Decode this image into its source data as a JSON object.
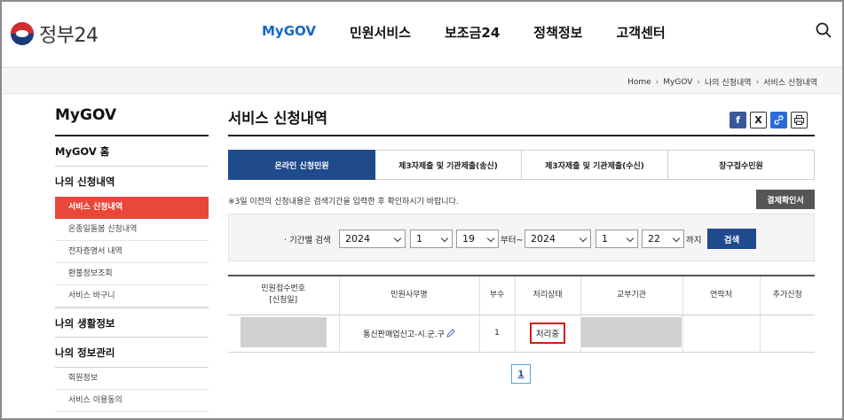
{
  "header": {
    "logo_text": "정부24",
    "nav": [
      "MyGOV",
      "민원서비스",
      "보조금24",
      "정책정보",
      "고객센터"
    ],
    "active_nav": "MyGOV"
  },
  "breadcrumb": [
    "Home",
    "MyGOV",
    "나의 신청내역",
    "서비스 신청내역"
  ],
  "sidebar": {
    "title": "MyGOV",
    "home": "MyGOV 홈",
    "section1": "나의 신청내역",
    "section1_items": [
      "서비스 신청내역",
      "온종일돌봄 신청내역",
      "전자증명서 내역",
      "환불정보조회",
      "서비스 바구니"
    ],
    "section2": "나의 생활정보",
    "section3": "나의 정보관리",
    "section3_items": [
      "회원정보",
      "서비스 이용동의"
    ]
  },
  "main": {
    "title": "서비스 신청내역",
    "share_icons": [
      "facebook-icon",
      "x-icon",
      "link-icon",
      "print-icon"
    ],
    "tabs": [
      "온라인 신청민원",
      "제3자제출 및 기관제출(송신)",
      "제3자제출 및 기관제출(수신)",
      "창구접수민원"
    ],
    "active_tab": 0,
    "notice": "※3일 이전의 신청내용은 검색기간을 입력한 후 확인하시기 바랍니다.",
    "cert_button": "결제확인서",
    "filter": {
      "label": "· 기간별 검색",
      "from_year": "2024",
      "from_month": "1",
      "from_day": "19",
      "from_suffix": "부터~",
      "to_year": "2024",
      "to_month": "1",
      "to_day": "22",
      "to_suffix": "까지",
      "search_button": "검색"
    },
    "table": {
      "headers": [
        "민원접수번호\n[신청일]",
        "민원사무명",
        "부수",
        "처리상태",
        "교부기관",
        "연락처",
        "추가신청"
      ],
      "rows": [
        {
          "receipt_no": "",
          "service_name": "통신판매업신고-시.군.구",
          "copies": "1",
          "status": "처리중",
          "agency": "",
          "contact": "",
          "extra": ""
        }
      ]
    },
    "pagination": {
      "current": "1"
    }
  }
}
